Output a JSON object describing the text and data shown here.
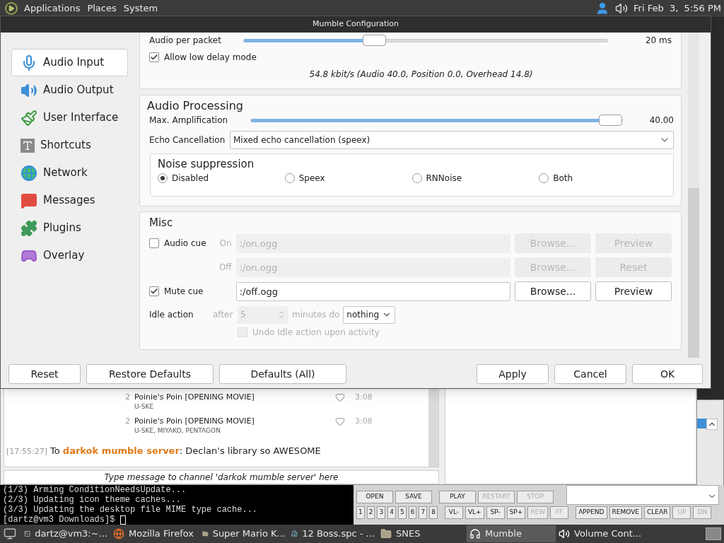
{
  "top_panel": {
    "menus": [
      "Applications",
      "Places",
      "System"
    ],
    "clock": "Fri Feb  3,  5:56 PM"
  },
  "dialog": {
    "title": "Mumble Configuration",
    "sidebar": [
      {
        "label": "Audio Input",
        "selected": true
      },
      {
        "label": "Audio Output",
        "selected": false
      },
      {
        "label": "User Interface",
        "selected": false
      },
      {
        "label": "Shortcuts",
        "selected": false
      },
      {
        "label": "Network",
        "selected": false
      },
      {
        "label": "Messages",
        "selected": false
      },
      {
        "label": "Plugins",
        "selected": false
      },
      {
        "label": "Overlay",
        "selected": false
      }
    ],
    "transmission": {
      "packet": {
        "label": "Audio per packet",
        "level": 0.35,
        "reading": "20 ms"
      },
      "low_delay": {
        "label": "Allow low delay mode",
        "checked": true
      },
      "bitrate": "54.8 kbit/s (Audio 40.0, Position 0.0, Overhead 14.8)"
    },
    "processing": {
      "title": "Audio Processing",
      "amplification": {
        "label": "Max. Amplification",
        "level": 1,
        "reading": "40.00"
      },
      "echo": {
        "label": "Echo Cancellation",
        "value": "Mixed echo cancellation (speex)"
      },
      "noise": {
        "title": "Noise suppression",
        "options": [
          {
            "label": "Disabled",
            "selected": true
          },
          {
            "label": "Speex",
            "selected": false
          },
          {
            "label": "RNNoise",
            "selected": false
          },
          {
            "label": "Both",
            "selected": false
          }
        ]
      }
    },
    "misc": {
      "title": "Misc",
      "rows": [
        {
          "check": {
            "label": "Audio cue",
            "checked": false
          },
          "label": "On",
          "file": ":/on.ogg",
          "disabled": true,
          "buttons": [
            "Browse...",
            "Preview"
          ]
        },
        {
          "label": "Off",
          "file": ":/on.ogg",
          "disabled": true,
          "buttons": [
            "Browse...",
            "Reset"
          ]
        },
        {
          "check": {
            "label": "Mute cue",
            "checked": true
          },
          "file": ":/off.ogg",
          "disabled": false,
          "buttons": [
            "Browse...",
            "Preview"
          ]
        }
      ],
      "idle": {
        "label": "Idle action",
        "after": "after",
        "minutes": "5",
        "minutes_label": "minutes do",
        "disabled": true,
        "action": "nothing",
        "undo": {
          "label": "Undo Idle action upon activity",
          "checked": false,
          "disabled": true
        }
      }
    },
    "buttons_left": [
      "Reset",
      "Restore Defaults",
      "Defaults (All)"
    ],
    "buttons_right": [
      "Apply",
      "Cancel",
      "OK"
    ]
  },
  "chat": {
    "tracks": [
      {
        "number": "2",
        "title": "Poinie's Poin [OPENING MOVIE]",
        "artist": "U-SKE",
        "duration": "3:08"
      },
      {
        "number": "2",
        "title": "Poinie's Poin [OPENING MOVIE]",
        "artist": "U-SKE, MIYAKO, PENTAGON",
        "duration": "3:08"
      }
    ],
    "message": {
      "time": "[17:55:27]",
      "text": "To **darkok mumble server**: Declan's library so AWESOME"
    },
    "input": {
      "placeholder": "Type message to channel 'darkok mumble server' here"
    }
  },
  "terminal": {
    "lines": [
      "(1/3) Arming ConditionNeedsUpdate...",
      "(2/3) Updating icon theme caches...",
      "(3/3) Updating the desktop file MIME type cache..."
    ],
    "prompt": "[dartz@vm3 Downloads]$ "
  },
  "player": {
    "rows": [
      [
        [
          {
            "label": "OPEN",
            "disabled": false
          },
          {
            "label": "SAVE",
            "disabled": false
          }
        ],
        [
          {
            "label": "PLAY",
            "disabled": false
          },
          {
            "label": "RESTART",
            "disabled": true
          },
          {
            "label": "STOP",
            "disabled": true
          }
        ]
      ],
      [
        [
          {
            "label": "1",
            "disabled": false
          },
          {
            "label": "2",
            "disabled": false
          },
          {
            "label": "3",
            "disabled": false
          },
          {
            "label": "4",
            "disabled": false
          },
          {
            "label": "5",
            "disabled": false
          },
          {
            "label": "6",
            "disabled": false
          },
          {
            "label": "7",
            "disabled": false
          },
          {
            "label": "8",
            "disabled": false
          }
        ],
        [
          {
            "label": "VL-",
            "disabled": false
          },
          {
            "label": "VL+",
            "disabled": false
          },
          {
            "label": "SP-",
            "disabled": false
          },
          {
            "label": "SP+",
            "disabled": false
          },
          {
            "label": "REW",
            "disabled": true
          },
          {
            "label": "FF",
            "disabled": true
          }
        ],
        [
          {
            "label": "APPEND",
            "disabled": false
          },
          {
            "label": "REMOVE",
            "disabled": false
          },
          {
            "label": "CLEAR",
            "disabled": false
          },
          {
            "label": "UP",
            "disabled": true
          },
          {
            "label": "DN",
            "disabled": true
          }
        ]
      ]
    ]
  },
  "taskbar": {
    "items": [
      {
        "label": "dartz@vm3:~...",
        "selected": false
      },
      {
        "label": "Mozilla Firefox",
        "selected": false
      },
      {
        "label": "Super Mario K...",
        "selected": false
      },
      {
        "label": "12 Boss.spc - ...",
        "selected": false
      },
      {
        "label": "SNES",
        "selected": false
      },
      {
        "label": "Mumble",
        "selected": true
      },
      {
        "label": "Volume Cont...",
        "selected": false
      }
    ]
  }
}
